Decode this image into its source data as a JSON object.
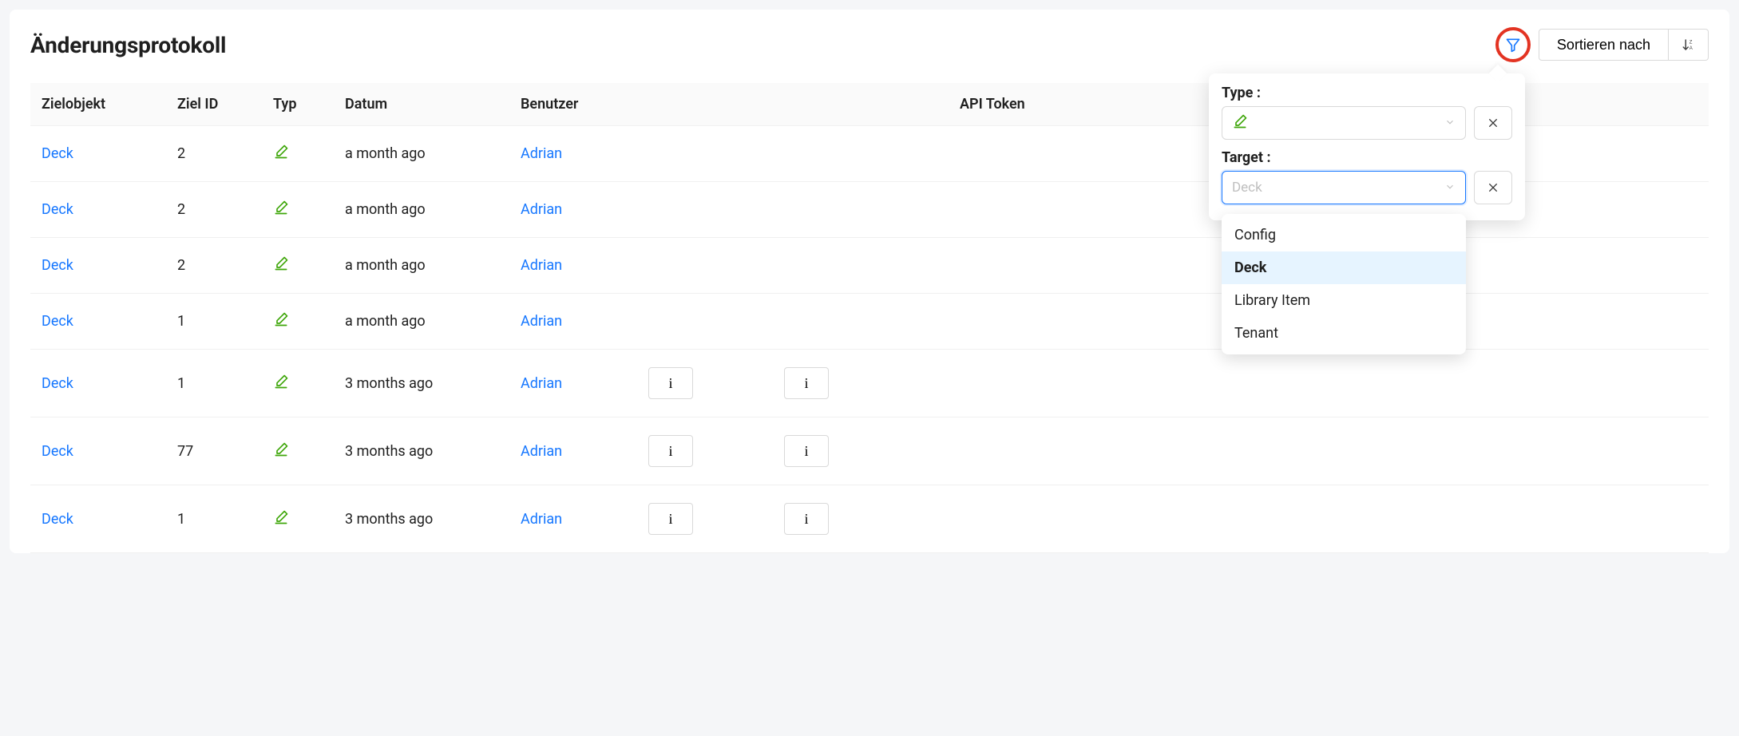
{
  "title": "Änderungsprotokoll",
  "header": {
    "sort_label": "Sortieren nach"
  },
  "columns": {
    "target": "Zielobjekt",
    "target_id": "Ziel ID",
    "type": "Typ",
    "date": "Datum",
    "user": "Benutzer",
    "api_token": "API Token"
  },
  "rows": [
    {
      "target": "Deck",
      "target_id": "2",
      "date": "a month ago",
      "user": "Adrian"
    },
    {
      "target": "Deck",
      "target_id": "2",
      "date": "a month ago",
      "user": "Adrian"
    },
    {
      "target": "Deck",
      "target_id": "2",
      "date": "a month ago",
      "user": "Adrian"
    },
    {
      "target": "Deck",
      "target_id": "1",
      "date": "a month ago",
      "user": "Adrian"
    },
    {
      "target": "Deck",
      "target_id": "1",
      "date": "3 months ago",
      "user": "Adrian"
    },
    {
      "target": "Deck",
      "target_id": "77",
      "date": "3 months ago",
      "user": "Adrian"
    },
    {
      "target": "Deck",
      "target_id": "1",
      "date": "3 months ago",
      "user": "Adrian"
    }
  ],
  "info_button_label": "i",
  "filter": {
    "type_label": "Type :",
    "target_label": "Target :",
    "target_placeholder": "Deck",
    "options": [
      "Config",
      "Deck",
      "Library Item",
      "Tenant"
    ],
    "selected_option": "Deck"
  }
}
